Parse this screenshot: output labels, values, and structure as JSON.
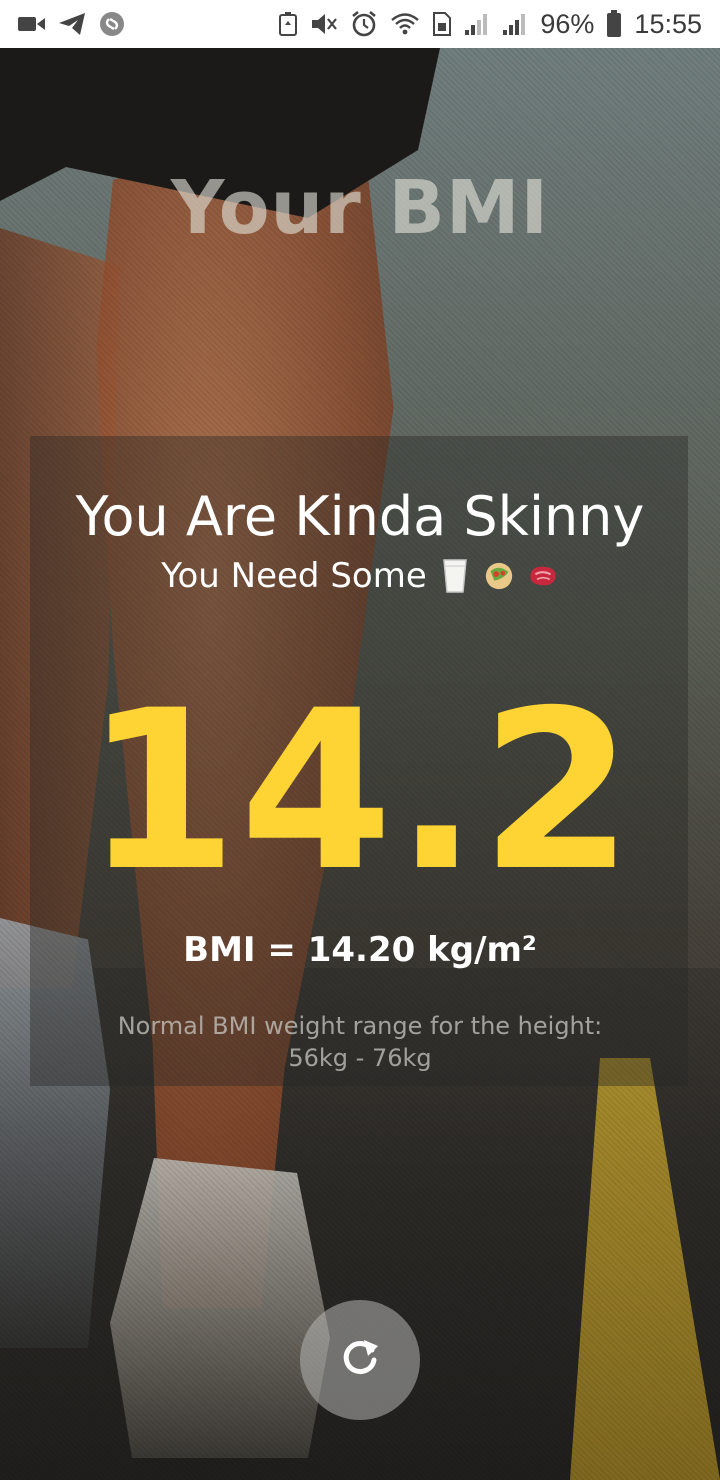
{
  "status_bar": {
    "battery": "96%",
    "time": "15:55"
  },
  "screen": {
    "title": "Your BMI"
  },
  "result": {
    "status": "You Are Kinda Skinny",
    "advice": "You Need Some",
    "advice_icons": [
      "milk-glass-icon",
      "burrito-icon",
      "steak-icon"
    ],
    "bmi_value": "14.2",
    "bmi_formula": "BMI = 14.20 kg/m²",
    "range_label": "Normal BMI weight range for the height:",
    "range_value": "56kg - 76kg"
  },
  "actions": {
    "refresh_icon": "refresh-icon"
  },
  "colors": {
    "accent": "#fdd434",
    "status_bar_bg": "#ffffff"
  }
}
